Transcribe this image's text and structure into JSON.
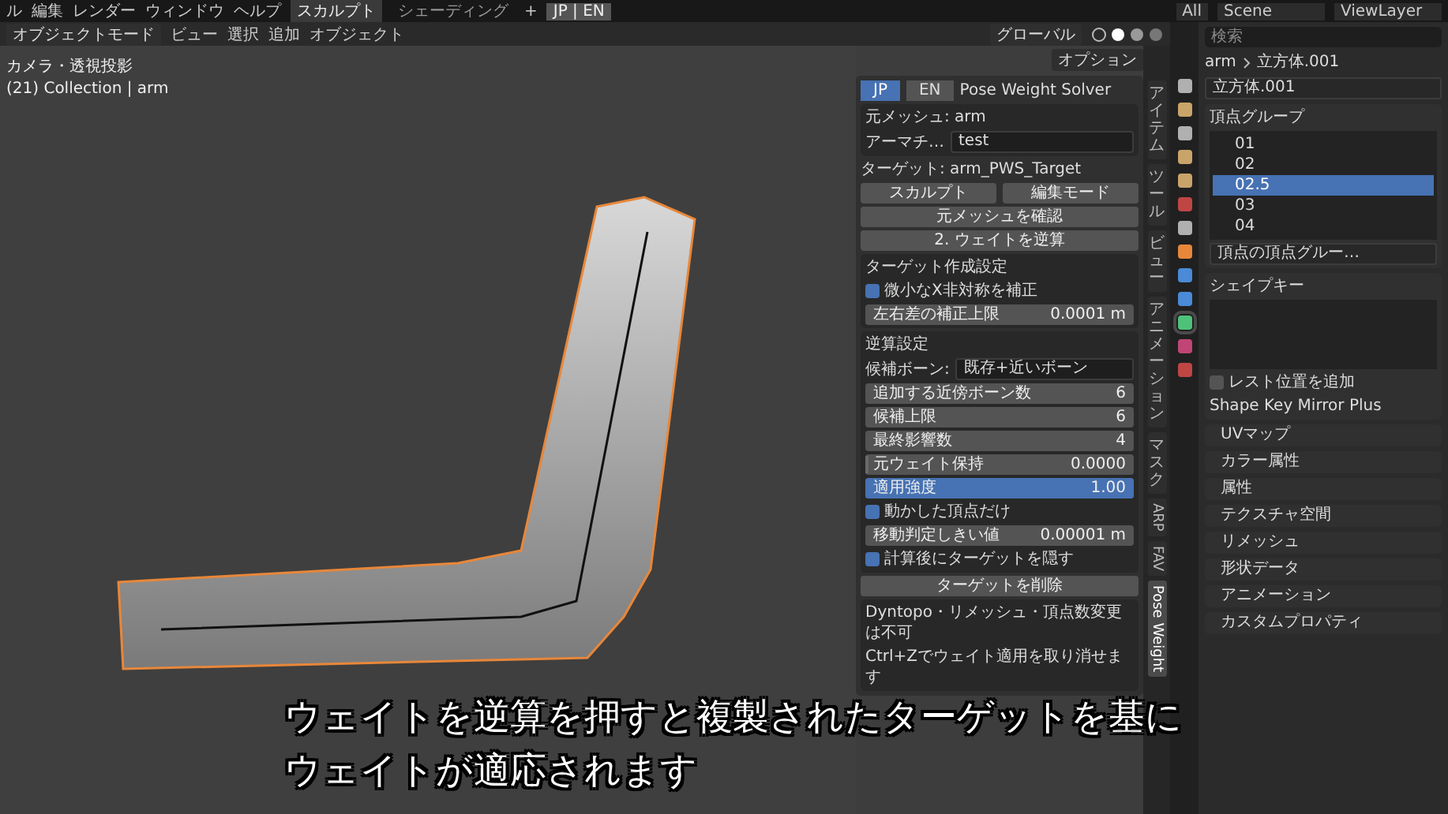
{
  "top_bar": {
    "menus": [
      "ル",
      "編集",
      "レンダー",
      "ウィンドウ",
      "ヘルプ"
    ],
    "workspaces": [
      {
        "label": "スカルプト",
        "selected": true
      },
      {
        "label": "シェーディング",
        "selected": false
      }
    ],
    "add_workspace": "+",
    "language": "JP | EN",
    "view_filter": "All",
    "scene": "Scene",
    "view_layer": "ViewLayer"
  },
  "viewport": {
    "mode": "オブジェクトモード",
    "menus": [
      "ビュー",
      "選択",
      "追加",
      "オブジェクト"
    ],
    "orientation": "グローバル",
    "options": "オプション",
    "view_label": "カメラ・透視投影",
    "collection_label": "(21) Collection | arm"
  },
  "npanel": {
    "lang_tabs": [
      {
        "label": "JP",
        "selected": true
      },
      {
        "label": "EN",
        "selected": false
      }
    ],
    "title": "Pose Weight Solver",
    "source_mesh": "元メッシュ: arm",
    "armature_label": "アーマチ…",
    "armature_value": "test",
    "target": "ターゲット: arm_PWS_Target",
    "sculpt_button": "スカルプト",
    "edit_button": "編集モード",
    "check_button": "元メッシュを確認",
    "solve_button": "2. ウェイトを逆算",
    "target_settings": {
      "title": "ターゲット作成設定",
      "checkbox": {
        "label": "微小なX非対称を補正",
        "checked": true
      },
      "field": {
        "label": "左右差の補正上限",
        "value": "0.0001 m"
      }
    },
    "solve_settings": {
      "title": "逆算設定",
      "candidate_label": "候補ボーン:",
      "candidate_value": "既存+近いボーン",
      "rows": [
        {
          "kind": "field",
          "label": "追加する近傍ボーン数",
          "value": "6"
        },
        {
          "kind": "field",
          "label": "候補上限",
          "value": "6"
        },
        {
          "kind": "field",
          "label": "最終影響数",
          "value": "4"
        },
        {
          "kind": "slider",
          "label": "元ウェイト保持",
          "value": "0.0000",
          "level": 0
        },
        {
          "kind": "slider",
          "label": "適用強度",
          "value": "1.00",
          "level": 1
        },
        {
          "kind": "checkbox",
          "label": "動かした頂点だけ",
          "checked": true
        },
        {
          "kind": "field",
          "label": "移動判定しきい値",
          "value": "0.00001 m"
        },
        {
          "kind": "checkbox",
          "label": "計算後にターゲットを隠す",
          "checked": true
        }
      ]
    },
    "delete_button": "ターゲットを削除",
    "notes": [
      "Dyntopo・リメッシュ・頂点数変更は不可",
      "Ctrl+Zでウェイト適用を取り消せます"
    ]
  },
  "side_tabs": [
    {
      "label": "アイテム",
      "kind": "cjk",
      "selected": false
    },
    {
      "label": "ツール",
      "kind": "cjk",
      "selected": false
    },
    {
      "label": "ビュー",
      "kind": "cjk",
      "selected": false
    },
    {
      "label": "アニメーション",
      "kind": "cjk",
      "selected": false
    },
    {
      "label": "マスク",
      "kind": "cjk",
      "selected": false
    },
    {
      "label": "ARP",
      "kind": "latin",
      "selected": false
    },
    {
      "label": "FAV",
      "kind": "latin",
      "selected": false
    },
    {
      "label": "Pose Weight",
      "kind": "latin",
      "selected": true
    }
  ],
  "properties": {
    "tabs": [
      {
        "selected": false
      },
      {
        "selected": false
      },
      {
        "selected": false
      },
      {
        "selected": false
      },
      {
        "selected": false
      },
      {
        "selected": false
      },
      {
        "selected": false
      },
      {
        "selected": false
      },
      {
        "selected": false
      },
      {
        "selected": false
      },
      {
        "selected": true
      },
      {
        "selected": false
      },
      {
        "selected": false
      }
    ],
    "search_placeholder": "検索",
    "breadcrumb": [
      "arm",
      "立方体.001"
    ],
    "mesh_name": "立方体.001",
    "vertex_groups": {
      "title": "頂点グループ",
      "items": [
        {
          "name": "01",
          "selected": false
        },
        {
          "name": "02",
          "selected": false
        },
        {
          "name": "02.5",
          "selected": true
        },
        {
          "name": "03",
          "selected": false
        },
        {
          "name": "04",
          "selected": false
        }
      ],
      "filter": "頂点の頂点グルー…"
    },
    "shape_keys": {
      "title": "シェイプキー",
      "rest_checkbox": {
        "label": "レスト位置を追加",
        "checked": false
      },
      "addon": "Shape Key Mirror Plus"
    },
    "sections": [
      "UVマップ",
      "カラー属性",
      "属性",
      "テクスチャ空間",
      "リメッシュ",
      "形状データ",
      "アニメーション",
      "カスタムプロパティ"
    ]
  },
  "subtitle": [
    "ウェイトを逆算を押すと複製されたターゲットを基に",
    "ウェイトが適応されます"
  ]
}
